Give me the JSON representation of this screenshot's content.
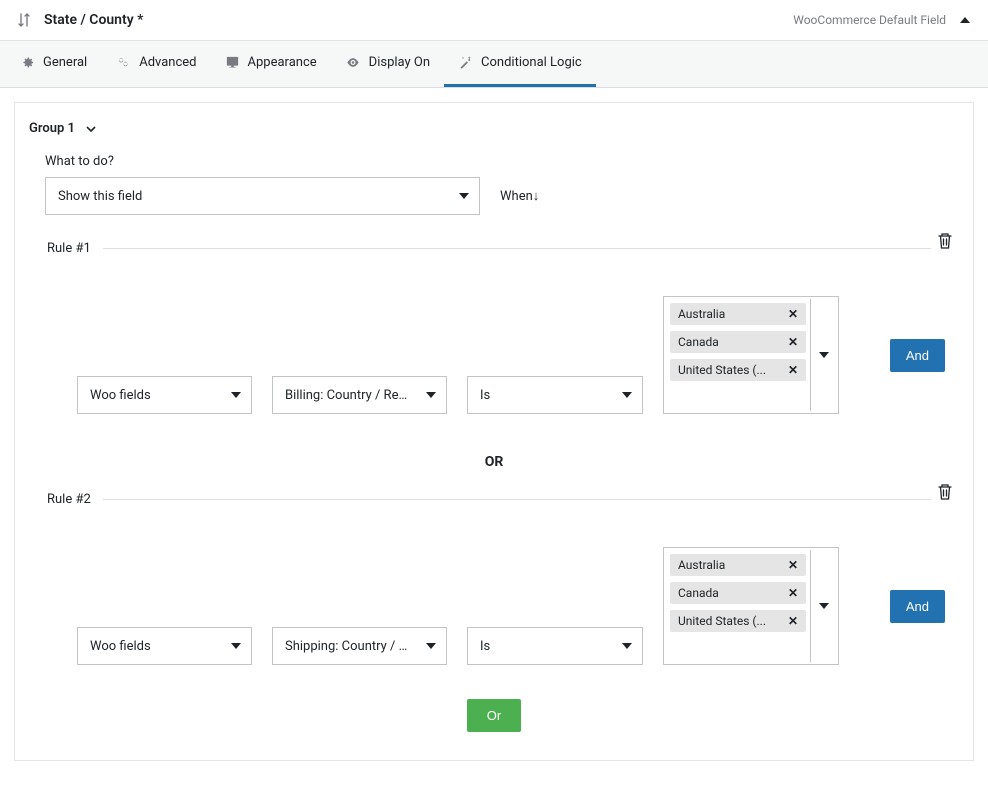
{
  "header": {
    "title": "State / County *",
    "rightLabel": "WooCommerce Default Field"
  },
  "tabs": [
    {
      "label": "General",
      "icon": "gear-icon"
    },
    {
      "label": "Advanced",
      "icon": "gears-icon"
    },
    {
      "label": "Appearance",
      "icon": "monitor-icon"
    },
    {
      "label": "Display On",
      "icon": "eye-icon"
    },
    {
      "label": "Conditional Logic",
      "icon": "wand-icon"
    }
  ],
  "group": {
    "title": "Group 1",
    "whatToDoLabel": "What to do?",
    "action": "Show this field",
    "whenLabel": "When↓",
    "orDivider": "OR",
    "buttons": {
      "and": "And",
      "or": "Or"
    },
    "rules": [
      {
        "legend": "Rule #1",
        "source": "Woo fields",
        "field": "Billing: Country / Regi...",
        "operator": "Is",
        "values": [
          "Australia",
          "Canada",
          "United States (..."
        ]
      },
      {
        "legend": "Rule #2",
        "source": "Woo fields",
        "field": "Shipping: Country / R...",
        "operator": "Is",
        "values": [
          "Australia",
          "Canada",
          "United States (..."
        ]
      }
    ]
  }
}
